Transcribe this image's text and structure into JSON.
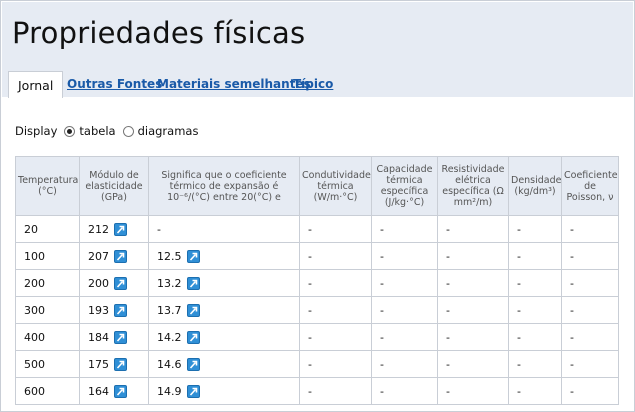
{
  "page": {
    "title": "Propriedades físicas"
  },
  "tabs": {
    "active": "Jornal",
    "links": [
      "Outras Fontes",
      "Materiais semelhantes",
      "Típico"
    ]
  },
  "display": {
    "label": "Display",
    "options": [
      "tabela",
      "diagramas"
    ],
    "selected": "tabela"
  },
  "table": {
    "headers": [
      "Temperatura (°C)",
      "Módulo de elasticidade (GPa)",
      "Significa que o coeficiente térmico de expansão é 10⁻⁶/(°C) entre 20(°C) e",
      "Condutividade térmica (W/m·°C)",
      "Capacidade térmica específica (J/kg·°C)",
      "Resistividade elétrica específica (Ω mm²/m)",
      "Densidade (kg/dm³)",
      "Coeficiente de Poisson, ν"
    ],
    "rows": [
      {
        "temp": "20",
        "modulus": "212",
        "expansion": "-",
        "conductivity": "-",
        "heat_capacity": "-",
        "resistivity": "-",
        "density": "-",
        "poisson": "-"
      },
      {
        "temp": "100",
        "modulus": "207",
        "expansion": "12.5",
        "conductivity": "-",
        "heat_capacity": "-",
        "resistivity": "-",
        "density": "-",
        "poisson": "-"
      },
      {
        "temp": "200",
        "modulus": "200",
        "expansion": "13.2",
        "conductivity": "-",
        "heat_capacity": "-",
        "resistivity": "-",
        "density": "-",
        "poisson": "-"
      },
      {
        "temp": "300",
        "modulus": "193",
        "expansion": "13.7",
        "conductivity": "-",
        "heat_capacity": "-",
        "resistivity": "-",
        "density": "-",
        "poisson": "-"
      },
      {
        "temp": "400",
        "modulus": "184",
        "expansion": "14.2",
        "conductivity": "-",
        "heat_capacity": "-",
        "resistivity": "-",
        "density": "-",
        "poisson": "-"
      },
      {
        "temp": "500",
        "modulus": "175",
        "expansion": "14.6",
        "conductivity": "-",
        "heat_capacity": "-",
        "resistivity": "-",
        "density": "-",
        "poisson": "-"
      },
      {
        "temp": "600",
        "modulus": "164",
        "expansion": "14.9",
        "conductivity": "-",
        "heat_capacity": "-",
        "resistivity": "-",
        "density": "-",
        "poisson": "-"
      }
    ]
  },
  "icons": {
    "chart_link": "chart-link-icon"
  },
  "colors": {
    "header_bg": "#e6ebf3",
    "link": "#1a5aa8",
    "border": "#c9ced6",
    "icon_blue": "#2f8fd6"
  }
}
